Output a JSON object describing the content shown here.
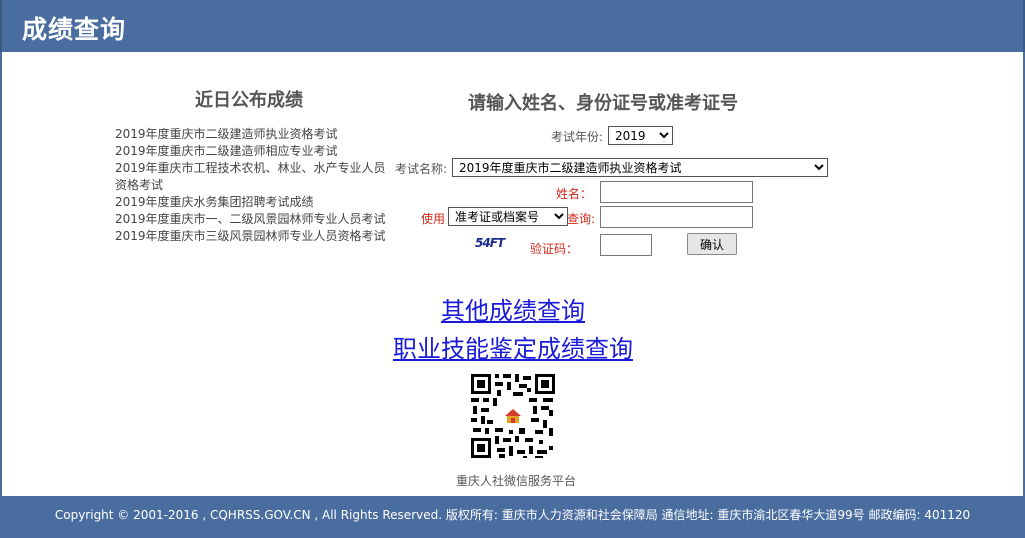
{
  "header": {
    "title": "成绩查询"
  },
  "left": {
    "title": "近日公布成绩",
    "items": [
      "2019年度重庆市二级建造师执业资格考试",
      "2019年度重庆市二级建造师相应专业考试",
      "2019年重庆市工程技术农机、林业、水产专业人员资格考试",
      "2019年度重庆水务集团招聘考试成绩",
      "2019年度重庆市一、二级风景园林师专业人员考试",
      "2019年度重庆市三级风景园林师专业人员资格考试"
    ]
  },
  "form": {
    "title": "请输入姓名、身份证号或准考证号",
    "year_label": "考试年份:",
    "year_value": "2019",
    "exam_label": "考试名称:",
    "exam_value": "2019年度重庆市二级建造师执业资格考试",
    "name_label": "姓名：",
    "use_label": "使用",
    "id_type_value": "准考证或档案号",
    "query_label": "查询:",
    "captcha_label": "验证码：",
    "captcha_text": "54FT",
    "confirm_label": "确认"
  },
  "links": {
    "other": "其他成绩查询",
    "skill": "职业技能鉴定成绩查询"
  },
  "qr": {
    "caption": "重庆人社微信服务平台"
  },
  "footer": {
    "text": "Copyright © 2001-2016 , CQHRSS.GOV.CN , All Rights Reserved. 版权所有: 重庆市人力资源和社会保障局 通信地址: 重庆市渝北区春华大道99号 邮政编码: 401120"
  },
  "colors": {
    "header": "#4a6da0",
    "link": "#1a1adb",
    "label_red": "#d1281b"
  }
}
